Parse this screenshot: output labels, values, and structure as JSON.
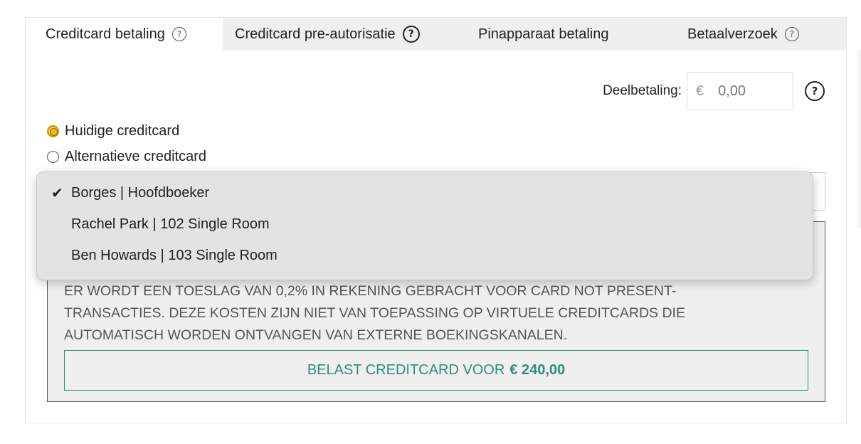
{
  "tabs": [
    {
      "label": "Creditcard betaling",
      "help": "?",
      "active": true
    },
    {
      "label": "Creditcard pre-autorisatie",
      "help": "?",
      "active": false
    },
    {
      "label": "Pinapparaat betaling",
      "active": false
    },
    {
      "label": "Betaalverzoek",
      "help": "?",
      "active": false
    }
  ],
  "partial_payment": {
    "label": "Deelbetaling:",
    "currency": "€",
    "value": "0,00",
    "help": "?"
  },
  "card_options": [
    {
      "label": "Huidige creditcard",
      "selected": true
    },
    {
      "label": "Alternatieve creditcard",
      "selected": false
    }
  ],
  "payer_dropdown": {
    "check": "✔",
    "options": [
      {
        "label": "Borges | Hoofdboeker",
        "selected": true
      },
      {
        "label": "Rachel Park | 102 Single Room",
        "selected": false
      },
      {
        "label": "Ben Howards | 103 Single Room",
        "selected": false
      }
    ]
  },
  "notice": "Er wordt een toeslag van 0,2% in rekening gebracht voor card not present-transacties. Deze kosten zijn niet van toepassing op virtuele creditcards die automatisch worden ontvangen van externe boekingskanalen.",
  "charge_button": {
    "label": "BELAST CREDITCARD VOOR",
    "amount": "€ 240,00"
  },
  "colors": {
    "accent_green": "#2e8e7b",
    "radio_selected": "#f5b51e",
    "tab_bar": "#efefef"
  }
}
